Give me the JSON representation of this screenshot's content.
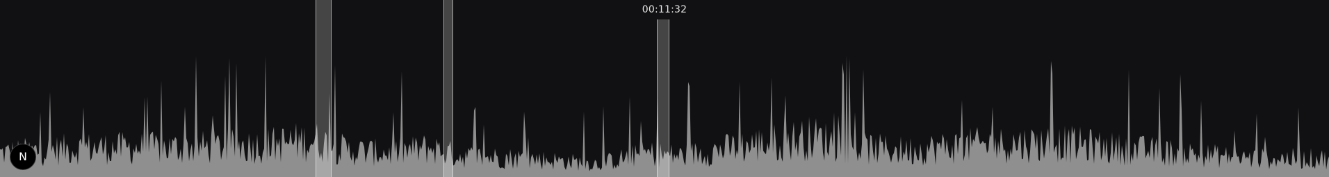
{
  "timeline": {
    "hover_time": "00:11:32"
  },
  "badge": {
    "letter": "N"
  },
  "colors": {
    "background": "#111113",
    "waveform": "#8f8f8f",
    "region": "#ffffff"
  },
  "icons": {
    "badge_icon": "n-logo-icon"
  }
}
